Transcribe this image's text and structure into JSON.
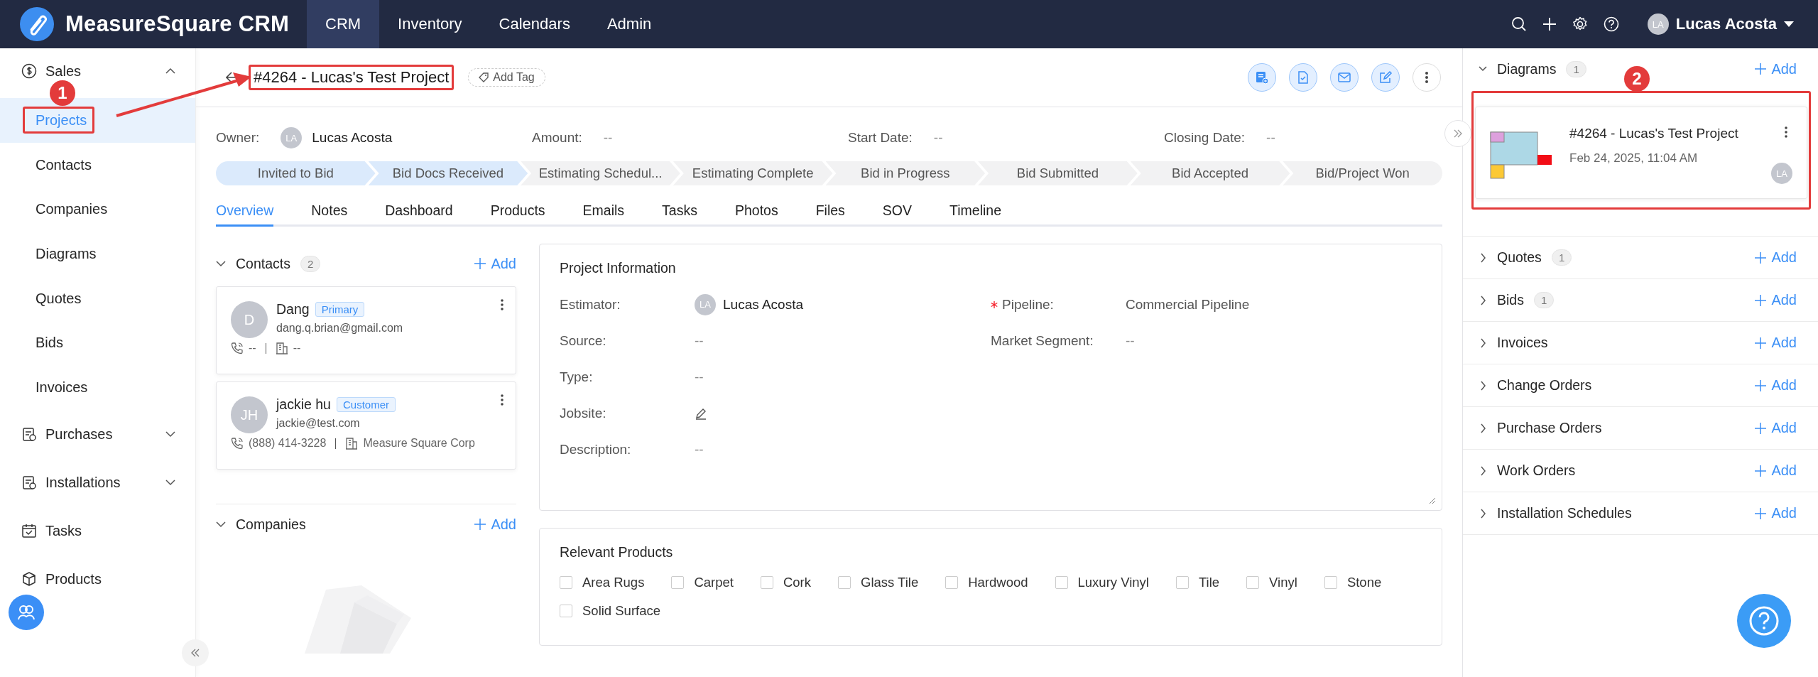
{
  "app": {
    "name": "MeasureSquare CRM"
  },
  "top_nav": [
    {
      "label": "CRM",
      "selected": true
    },
    {
      "label": "Inventory",
      "selected": false
    },
    {
      "label": "Calendars",
      "selected": false
    },
    {
      "label": "Admin",
      "selected": false
    }
  ],
  "user": {
    "initials": "LA",
    "name": "Lucas Acosta"
  },
  "sidebar": [
    {
      "kind": "group",
      "label": "Sales",
      "expanded": true,
      "children": [
        {
          "label": "Projects",
          "selected": true
        },
        {
          "label": "Contacts",
          "selected": false
        },
        {
          "label": "Companies",
          "selected": false
        },
        {
          "label": "Diagrams",
          "selected": false
        },
        {
          "label": "Quotes",
          "selected": false
        },
        {
          "label": "Bids",
          "selected": false
        },
        {
          "label": "Invoices",
          "selected": false
        }
      ]
    },
    {
      "kind": "group",
      "label": "Purchases",
      "expanded": false
    },
    {
      "kind": "group",
      "label": "Installations",
      "expanded": false
    },
    {
      "kind": "link",
      "label": "Tasks"
    },
    {
      "kind": "link",
      "label": "Products"
    }
  ],
  "project": {
    "title": "#4264 - Lucas's Test Project",
    "add_tag": "Add Tag"
  },
  "summary": [
    {
      "label": "Owner:",
      "value": "Lucas Acosta",
      "initials": "LA"
    },
    {
      "label": "Amount:",
      "value": "--"
    },
    {
      "label": "Start Date:",
      "value": "--"
    },
    {
      "label": "Closing Date:",
      "value": "--"
    }
  ],
  "pipeline_stages": [
    {
      "label": "Invited to Bid",
      "completed": true
    },
    {
      "label": "Bid Docs Received",
      "completed": true
    },
    {
      "label": "Estimating Schedul...",
      "completed": false
    },
    {
      "label": "Estimating Complete",
      "completed": false
    },
    {
      "label": "Bid in Progress",
      "completed": false
    },
    {
      "label": "Bid Submitted",
      "completed": false
    },
    {
      "label": "Bid Accepted",
      "completed": false
    },
    {
      "label": "Bid/Project Won",
      "completed": false
    }
  ],
  "tabs": [
    {
      "label": "Overview",
      "selected": true
    },
    {
      "label": "Notes",
      "selected": false
    },
    {
      "label": "Dashboard",
      "selected": false
    },
    {
      "label": "Products",
      "selected": false
    },
    {
      "label": "Emails",
      "selected": false
    },
    {
      "label": "Tasks",
      "selected": false
    },
    {
      "label": "Photos",
      "selected": false
    },
    {
      "label": "Files",
      "selected": false
    },
    {
      "label": "SOV",
      "selected": false
    },
    {
      "label": "Timeline",
      "selected": false
    }
  ],
  "contacts": {
    "title": "Contacts",
    "count": "2",
    "add": "Add",
    "items": [
      {
        "initials": "D",
        "name": "Dang",
        "tag": "Primary",
        "email": "dang.q.brian@gmail.com",
        "phone": "--",
        "company": "--"
      },
      {
        "initials": "JH",
        "name": "jackie hu",
        "tag": "Customer",
        "email": "jackie@test.com",
        "phone": "(888) 414-3228",
        "company": "Measure Square Corp"
      }
    ]
  },
  "companies": {
    "title": "Companies",
    "add": "Add"
  },
  "project_information": {
    "title": "Project Information",
    "left_fields": [
      {
        "kind": "person",
        "label": "Estimator:",
        "initials": "LA",
        "value": "Lucas Acosta"
      },
      {
        "kind": "text",
        "label": "Source:",
        "value": "--"
      },
      {
        "kind": "text",
        "label": "Type:",
        "value": "--"
      },
      {
        "kind": "edit",
        "label": "Jobsite:"
      },
      {
        "kind": "text",
        "label": "Description:",
        "value": "--"
      }
    ],
    "right_fields": [
      {
        "label": "Pipeline:",
        "required": true,
        "value": "Commercial Pipeline"
      },
      {
        "label": "Market Segment:",
        "required": false,
        "value": "--"
      }
    ]
  },
  "relevant_products": {
    "title": "Relevant Products",
    "options": [
      {
        "label": "Area Rugs",
        "checked": false
      },
      {
        "label": "Carpet",
        "checked": false
      },
      {
        "label": "Cork",
        "checked": false
      },
      {
        "label": "Glass Tile",
        "checked": false
      },
      {
        "label": "Hardwood",
        "checked": false
      },
      {
        "label": "Luxury Vinyl",
        "checked": false
      },
      {
        "label": "Tile",
        "checked": false
      },
      {
        "label": "Vinyl",
        "checked": false
      },
      {
        "label": "Stone",
        "checked": false
      },
      {
        "label": "Solid Surface",
        "checked": false
      }
    ]
  },
  "right_panel": [
    {
      "title": "Diagrams",
      "count": "1",
      "expanded": true,
      "add": "Add",
      "items": [
        {
          "title": "#4264 - Lucas's Test Project",
          "date": "Feb 24, 2025, 11:04 AM",
          "initials": "LA"
        }
      ]
    },
    {
      "title": "Quotes",
      "count": "1",
      "expanded": false,
      "add": "Add"
    },
    {
      "title": "Bids",
      "count": "1",
      "expanded": false,
      "add": "Add"
    },
    {
      "title": "Invoices",
      "expanded": false,
      "add": "Add"
    },
    {
      "title": "Change Orders",
      "expanded": false,
      "add": "Add"
    },
    {
      "title": "Purchase Orders",
      "expanded": false,
      "add": "Add"
    },
    {
      "title": "Work Orders",
      "expanded": false,
      "add": "Add"
    },
    {
      "title": "Installation Schedules",
      "expanded": false,
      "add": "Add"
    }
  ],
  "annotations": [
    {
      "label": "1"
    },
    {
      "label": "2"
    }
  ]
}
